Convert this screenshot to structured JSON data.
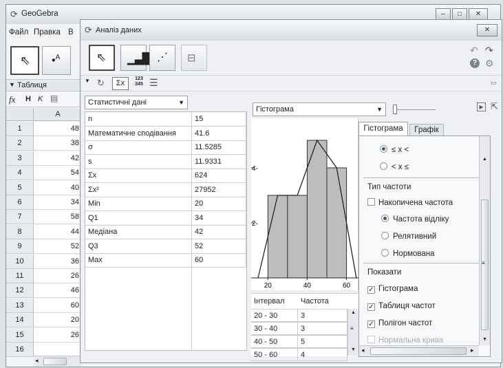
{
  "main_window": {
    "title": "GeoGebra",
    "menu": [
      "Файл",
      "Правка",
      "В"
    ],
    "view_title": "Таблиця",
    "formula_bar": {
      "fx": "fx",
      "bold": "H",
      "italic": "K"
    },
    "column_header": "A",
    "rows": [
      {
        "n": "1",
        "v": "48"
      },
      {
        "n": "2",
        "v": "38"
      },
      {
        "n": "3",
        "v": "42"
      },
      {
        "n": "4",
        "v": "54"
      },
      {
        "n": "5",
        "v": "40"
      },
      {
        "n": "6",
        "v": "34"
      },
      {
        "n": "7",
        "v": "58"
      },
      {
        "n": "8",
        "v": "44"
      },
      {
        "n": "9",
        "v": "52"
      },
      {
        "n": "10",
        "v": "36"
      },
      {
        "n": "11",
        "v": "26"
      },
      {
        "n": "12",
        "v": "46"
      },
      {
        "n": "13",
        "v": "60"
      },
      {
        "n": "14",
        "v": "20"
      },
      {
        "n": "15",
        "v": "26"
      },
      {
        "n": "16",
        "v": ""
      }
    ]
  },
  "dialog": {
    "title": "Аналіз даних",
    "stats_label": "Σx",
    "sample_icon": "123 345",
    "stats_combo": "Статистичні дані",
    "stats": [
      {
        "label": "n",
        "value": "15"
      },
      {
        "label": "Математичне сподівання",
        "value": "41.6"
      },
      {
        "label": "σ",
        "value": "11.5285"
      },
      {
        "label": "s",
        "value": "11.9331"
      },
      {
        "label": "Σx",
        "value": "624"
      },
      {
        "label": "Σx²",
        "value": "27952"
      },
      {
        "label": "Min",
        "value": "20"
      },
      {
        "label": "Q1",
        "value": "34"
      },
      {
        "label": "Медіана",
        "value": "42"
      },
      {
        "label": "Q3",
        "value": "52"
      },
      {
        "label": "Max",
        "value": "60"
      }
    ],
    "plot_combo": "Гістограма",
    "freq_table": {
      "headers": [
        "Інтервал",
        "Частота"
      ],
      "rows": [
        {
          "interval": "20 - 30",
          "freq": "3"
        },
        {
          "interval": "30 - 40",
          "freq": "3"
        },
        {
          "interval": "40 - 50",
          "freq": "5"
        },
        {
          "interval": "50 - 60",
          "freq": "4"
        }
      ]
    },
    "options": {
      "tabs": [
        "Гістограма",
        "Графік"
      ],
      "rule_options": [
        "≤ x <",
        "< x ≤"
      ],
      "freq_type_title": "Тип частоти",
      "cumulative": "Накопичена частота",
      "freq_types": [
        "Частота відліку",
        "Релятивний",
        "Нормована"
      ],
      "show_title": "Показати",
      "show": [
        {
          "label": "Гістограма",
          "checked": true
        },
        {
          "label": "Таблиця частот",
          "checked": true
        },
        {
          "label": "Полігон частот",
          "checked": true
        },
        {
          "label": "Нормальна крива",
          "checked": false
        }
      ]
    }
  },
  "chart_data": {
    "type": "bar",
    "categories": [
      "20 - 30",
      "30 - 40",
      "40 - 50",
      "50 - 60"
    ],
    "bins": [
      [
        20,
        30
      ],
      [
        30,
        40
      ],
      [
        40,
        50
      ],
      [
        50,
        60
      ]
    ],
    "values": [
      3,
      3,
      5,
      4
    ],
    "polygon": {
      "x": [
        15,
        25,
        35,
        45,
        55,
        65
      ],
      "y": [
        0,
        3,
        3,
        5,
        4,
        0
      ]
    },
    "xlim": [
      15,
      64
    ],
    "ylim": [
      0,
      5.6
    ],
    "xticks": [
      20,
      40,
      60
    ],
    "yticks": [
      2,
      4
    ],
    "title": "",
    "xlabel": "",
    "ylabel": "",
    "colors": {
      "bar": "#bdbdbd",
      "edge": "#333333"
    }
  }
}
